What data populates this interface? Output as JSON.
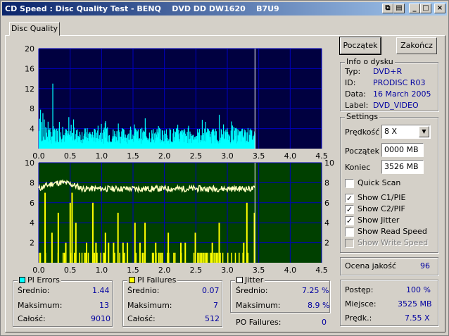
{
  "window": {
    "title": "CD Speed : Disc Quality Test - BENQ    DVD DD DW1620    B7U9"
  },
  "tab": "Disc Quality",
  "buttons": {
    "start": "Początek",
    "stop": "Zakończ"
  },
  "disc_info": {
    "legend": "Info o dysku",
    "type_label": "Typ:",
    "type": "DVD+R",
    "id_label": "ID:",
    "id": "PRODISC R03",
    "date_label": "Data:",
    "date": "16 March 2005",
    "label_label": "Label:",
    "label": "DVD_VIDEO"
  },
  "settings": {
    "legend": "Settings",
    "speed_label": "Prędkość",
    "speed": "8 X",
    "start_label": "Początek",
    "start": "0000 MB",
    "end_label": "Koniec",
    "end": "3526 MB",
    "quick_scan": "Quick Scan",
    "quick_scan_checked": false,
    "show_c1": "Show C1/PIE",
    "show_c1_checked": true,
    "show_c2": "Show C2/PIF",
    "show_c2_checked": true,
    "show_jitter": "Show Jitter",
    "show_jitter_checked": true,
    "show_read": "Show Read Speed",
    "show_read_checked": false,
    "show_write": "Show Write Speed",
    "show_write_checked": false
  },
  "quality": {
    "label": "Ocena jakość",
    "value": "96"
  },
  "progress": {
    "progress_label": "Postęp:",
    "progress": "100 %",
    "position_label": "Miejsce:",
    "position": "3525 MB",
    "speed_label": "Prędk.:",
    "speed": "7.55 X"
  },
  "pi_errors": {
    "legend": "PI Errors",
    "color": "#00ffff",
    "avg_label": "Średnio:",
    "avg": "1.44",
    "max_label": "Maksimum:",
    "max": "13",
    "total_label": "Całość:",
    "total": "9010"
  },
  "pi_failures": {
    "legend": "PI Failures",
    "color": "#ffff00",
    "avg_label": "Średnio:",
    "avg": "0.07",
    "max_label": "Maksimum:",
    "max": "7",
    "total_label": "Całość:",
    "total": "512"
  },
  "jitter": {
    "legend": "Jitter",
    "color": "#ffffff",
    "avg_label": "Średnio:",
    "avg": "7.25 %",
    "max_label": "Maksimum:",
    "max": "8.9 %"
  },
  "po_failures": {
    "label": "PO Failures:",
    "value": "0"
  },
  "chart_data": [
    {
      "type": "bar",
      "title": "",
      "series": [
        {
          "name": "PI Errors",
          "color": "#00ffff"
        }
      ],
      "x_ticks": [
        "0.0",
        "0.5",
        "1.0",
        "1.5",
        "2.0",
        "2.5",
        "3.0",
        "3.5",
        "4.0",
        "4.5"
      ],
      "y_ticks": [
        "20",
        "16",
        "12",
        "8",
        "4"
      ],
      "xlim": [
        0,
        4.5
      ],
      "ylim": [
        0,
        20
      ],
      "end_marker_x": 3.44,
      "background": "#000040",
      "grid_color": "#0000c0"
    },
    {
      "type": "line",
      "title": "",
      "series": [
        {
          "name": "PI Failures",
          "color": "#ffff00"
        },
        {
          "name": "Jitter",
          "color": "#ffffff"
        }
      ],
      "x_ticks": [
        "0.0",
        "0.5",
        "1.0",
        "1.5",
        "2.0",
        "2.5",
        "3.0",
        "3.5",
        "4.0",
        "4.5"
      ],
      "y_ticks_left": [
        "10",
        "8",
        "6",
        "4",
        "2"
      ],
      "y_ticks_right": [
        "10",
        "8",
        "6",
        "4",
        "2"
      ],
      "xlim": [
        0,
        4.5
      ],
      "ylim": [
        0,
        10
      ],
      "end_marker_x": 3.44,
      "background": "#004000",
      "grid_color": "#0000c0",
      "jitter_level_approx": 7.4,
      "pif_spikes": [
        {
          "x": 0.09,
          "y": 7
        },
        {
          "x": 0.2,
          "y": 3
        },
        {
          "x": 0.3,
          "y": 5
        },
        {
          "x": 0.42,
          "y": 2
        },
        {
          "x": 0.49,
          "y": 6
        },
        {
          "x": 0.52,
          "y": 7
        },
        {
          "x": 0.58,
          "y": 4
        },
        {
          "x": 0.75,
          "y": 2
        },
        {
          "x": 0.85,
          "y": 6
        },
        {
          "x": 0.9,
          "y": 2
        },
        {
          "x": 1.05,
          "y": 3
        },
        {
          "x": 1.1,
          "y": 2
        },
        {
          "x": 1.18,
          "y": 2
        },
        {
          "x": 1.25,
          "y": 5
        },
        {
          "x": 1.33,
          "y": 2
        },
        {
          "x": 1.4,
          "y": 2
        },
        {
          "x": 1.52,
          "y": 4
        },
        {
          "x": 1.6,
          "y": 2
        },
        {
          "x": 1.68,
          "y": 4
        },
        {
          "x": 1.85,
          "y": 2
        },
        {
          "x": 2.05,
          "y": 3
        },
        {
          "x": 2.25,
          "y": 2
        },
        {
          "x": 2.32,
          "y": 2
        },
        {
          "x": 2.48,
          "y": 3
        },
        {
          "x": 2.75,
          "y": 2
        },
        {
          "x": 2.86,
          "y": 4
        },
        {
          "x": 3.25,
          "y": 2
        },
        {
          "x": 3.3,
          "y": 6
        },
        {
          "x": 3.42,
          "y": 5
        }
      ]
    }
  ]
}
